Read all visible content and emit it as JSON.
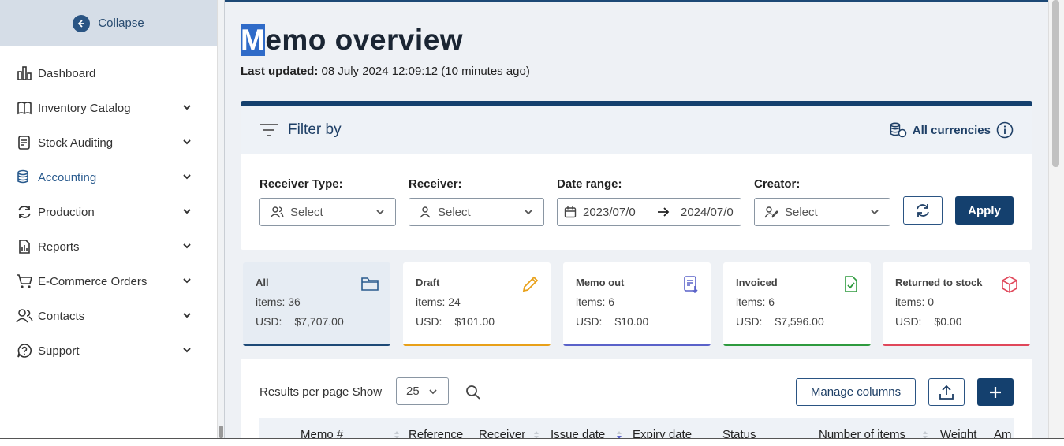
{
  "sidebar": {
    "collapse_label": "Collapse",
    "items": [
      {
        "label": "Dashboard",
        "icon": "chart-bar-icon",
        "has_chevron": false
      },
      {
        "label": "Inventory Catalog",
        "icon": "book-icon",
        "has_chevron": true
      },
      {
        "label": "Stock Auditing",
        "icon": "clipboard-icon",
        "has_chevron": true
      },
      {
        "label": "Accounting",
        "icon": "coins-icon",
        "has_chevron": true
      },
      {
        "label": "Production",
        "icon": "refresh-icon",
        "has_chevron": true
      },
      {
        "label": "Reports",
        "icon": "report-icon",
        "has_chevron": true
      },
      {
        "label": "E-Commerce Orders",
        "icon": "cart-icon",
        "has_chevron": true
      },
      {
        "label": "Contacts",
        "icon": "users-icon",
        "has_chevron": true
      },
      {
        "label": "Support",
        "icon": "help-icon",
        "has_chevron": true
      }
    ],
    "active_item": "Accounting"
  },
  "page": {
    "title_first": "M",
    "title_rest": "emo overview",
    "last_updated_label": "Last updated:",
    "last_updated_value": "08 July 2024 12:09:12 (10 minutes ago)"
  },
  "filter": {
    "title": "Filter by",
    "currencies_label": "All currencies",
    "receiver_type": {
      "label": "Receiver Type:",
      "placeholder": "Select"
    },
    "receiver": {
      "label": "Receiver:",
      "placeholder": "Select"
    },
    "date_range": {
      "label": "Date range:",
      "from": "2023/07/0",
      "to": "2024/07/0"
    },
    "creator": {
      "label": "Creator:",
      "placeholder": "Select"
    },
    "apply_label": "Apply"
  },
  "stats": [
    {
      "name": "All",
      "items_label": "items:",
      "items": "36",
      "currency": "USD:",
      "amount": "$7,707.00",
      "color": "#1d4976",
      "icon": "folder-icon"
    },
    {
      "name": "Draft",
      "items_label": "items:",
      "items": "24",
      "currency": "USD:",
      "amount": "$101.00",
      "color": "#e8a019",
      "icon": "pencil-icon"
    },
    {
      "name": "Memo out",
      "items_label": "items:",
      "items": "6",
      "currency": "USD:",
      "amount": "$10.00",
      "color": "#5a62c9",
      "icon": "memo-out-icon"
    },
    {
      "name": "Invoiced",
      "items_label": "items:",
      "items": "6",
      "currency": "USD:",
      "amount": "$7,596.00",
      "color": "#2e9a3e",
      "icon": "invoice-check-icon"
    },
    {
      "name": "Returned to stock",
      "items_label": "items:",
      "items": "0",
      "currency": "USD:",
      "amount": "$0.00",
      "color": "#e0475a",
      "icon": "box-icon"
    }
  ],
  "results": {
    "per_page_label": "Results per page Show",
    "per_page_value": "25",
    "manage_columns_label": "Manage columns",
    "columns": [
      "Memo #",
      "Reference",
      "Receiver",
      "Issue date",
      "Expiry date",
      "Status",
      "Number of items",
      "Weight",
      "Am"
    ]
  }
}
